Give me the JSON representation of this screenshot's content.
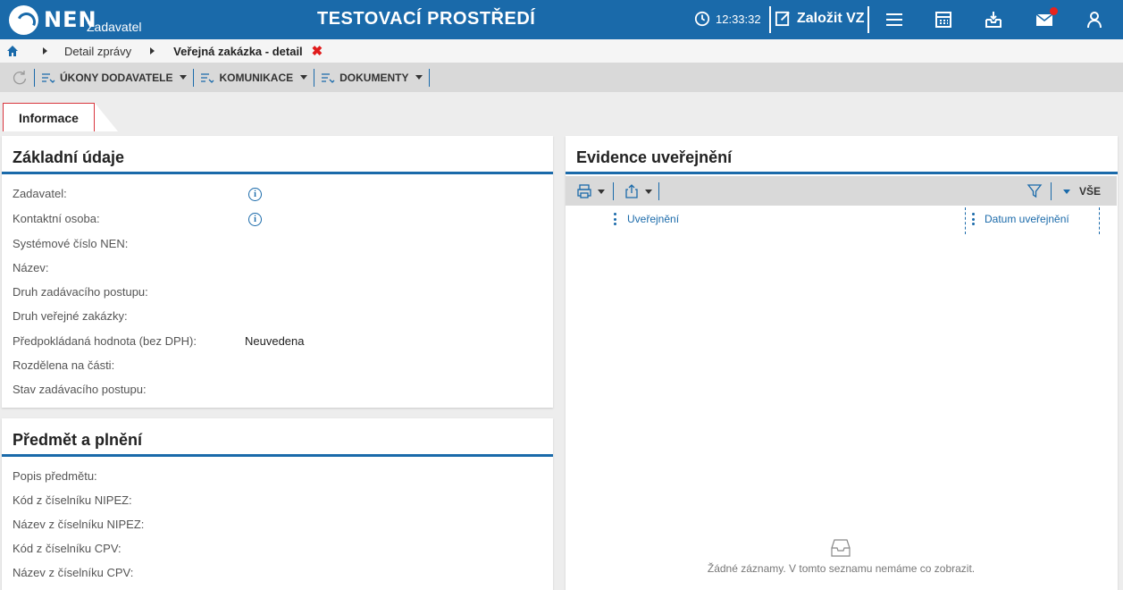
{
  "header": {
    "logo_text": "NEN",
    "logo_sub": "Zadavatel",
    "env_title": "TESTOVACÍ PROSTŘEDÍ",
    "clock_time": "12:33:32",
    "create_label": "Založit VZ"
  },
  "breadcrumb": {
    "items": [
      "Detail zprávy"
    ],
    "current": "Veřejná zakázka - detail",
    "close_glyph": "✖"
  },
  "actions": {
    "supplier_actions": "ÚKONY DODAVATELE",
    "communication": "KOMUNIKACE",
    "documents": "DOKUMENTY"
  },
  "tabs": {
    "active": "Informace"
  },
  "basic": {
    "title": "Základní údaje",
    "fields": [
      {
        "label": "Zadavatel:",
        "value": ""
      },
      {
        "label": "Kontaktní osoba:",
        "value": ""
      },
      {
        "label": "Systémové číslo NEN:",
        "value": ""
      },
      {
        "label": "Název:",
        "value": ""
      },
      {
        "label": "Druh zadávacího postupu:",
        "value": ""
      },
      {
        "label": "Druh veřejné zakázky:",
        "value": ""
      },
      {
        "label": "Předpokládaná hodnota (bez DPH):",
        "value": "Neuvedena"
      },
      {
        "label": "Rozdělena na části:",
        "value": ""
      },
      {
        "label": "Stav zadávacího postupu:",
        "value": ""
      }
    ]
  },
  "subject": {
    "title": "Předmět a plnění",
    "fields": [
      {
        "label": "Popis předmětu:"
      },
      {
        "label": "Kód z číselníku NIPEZ:"
      },
      {
        "label": "Název z číselníku NIPEZ:"
      },
      {
        "label": "Kód z číselníku CPV:"
      },
      {
        "label": "Název z číselníku CPV:"
      }
    ]
  },
  "publication": {
    "title": "Evidence uveřejnění",
    "filter_all": "VŠE",
    "columns": [
      "Uveřejnění",
      "Datum uveřejnění"
    ],
    "empty_text": "Žádné záznamy. V tomto seznamu nemáme co zobrazit."
  },
  "colors": {
    "primary": "#1a6aaa",
    "accent_red": "#e01b1b",
    "toolbar_gray": "#d9d9d9"
  },
  "icons": [
    "home-icon",
    "clock-icon",
    "edit-icon",
    "menu-icon",
    "calculator-icon",
    "inbox-icon",
    "mail-icon",
    "user-icon",
    "refresh-icon",
    "print-icon",
    "export-icon",
    "filter-icon",
    "info-icon",
    "empty-tray-icon"
  ]
}
